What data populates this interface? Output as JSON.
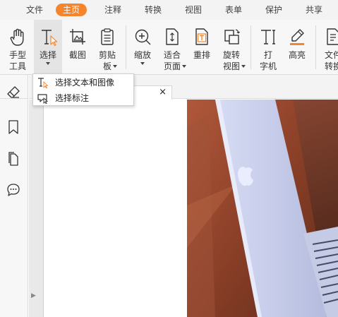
{
  "menu": {
    "tabs": [
      {
        "label": "文件"
      },
      {
        "label": "主页",
        "active": true
      },
      {
        "label": "注释"
      },
      {
        "label": "转换"
      },
      {
        "label": "视图"
      },
      {
        "label": "表单"
      },
      {
        "label": "保护"
      },
      {
        "label": "共享"
      }
    ],
    "active_color": "#f6842a"
  },
  "ribbon": {
    "tools": [
      {
        "label": "手型\n工具",
        "icon": "hand-icon"
      },
      {
        "label": "选择",
        "icon": "select-text-icon",
        "selected": true,
        "has_dropdown": true
      },
      {
        "label": "截图",
        "icon": "screenshot-icon"
      },
      {
        "label": "剪贴\n板",
        "icon": "clipboard-icon",
        "has_dropdown": true
      },
      {
        "label": "缩放",
        "icon": "zoom-icon",
        "has_dropdown": true
      },
      {
        "label": "适合\n页面",
        "icon": "fit-page-icon",
        "has_dropdown": true
      },
      {
        "label": "重排",
        "icon": "reflow-icon"
      },
      {
        "label": "旋转\n视图",
        "icon": "rotate-view-icon",
        "has_dropdown": true
      },
      {
        "label": "打\n字机",
        "icon": "typewriter-icon"
      },
      {
        "label": "高亮",
        "icon": "highlight-icon"
      },
      {
        "label": "文件\n转换",
        "icon": "file-convert-icon"
      }
    ]
  },
  "select_dropdown": {
    "items": [
      {
        "label": "选择文本和图像",
        "icon": "select-text-image-icon"
      },
      {
        "label": "选择标注",
        "icon": "select-annotation-icon"
      }
    ]
  },
  "leftnav": {
    "icons": [
      "eraser-icon",
      "bookmark-icon",
      "pages-icon",
      "comment-icon"
    ],
    "expand_arrow": "▶"
  },
  "doctab": {
    "close": "×"
  }
}
